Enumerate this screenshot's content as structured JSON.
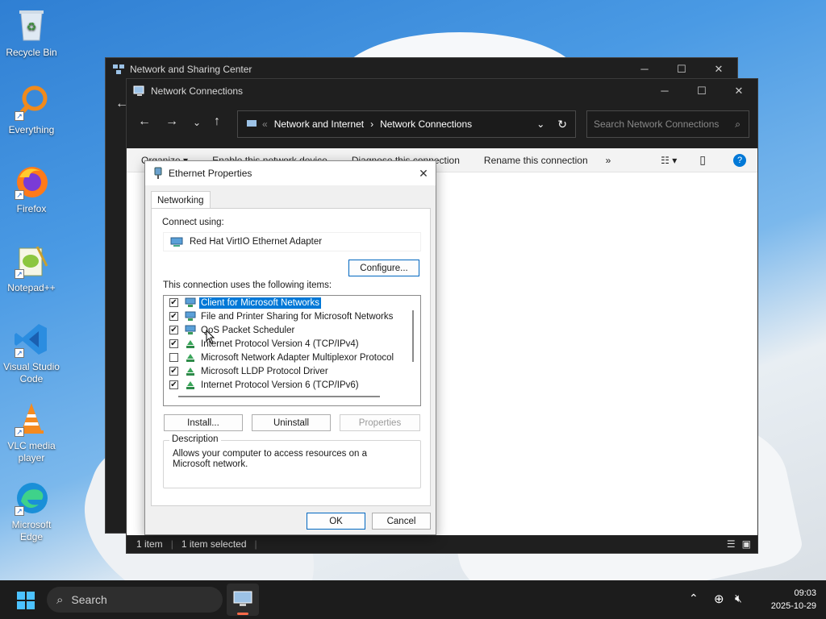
{
  "desktop": {
    "icons": [
      {
        "label": "Recycle Bin",
        "icon": "recycle-bin-icon"
      },
      {
        "label": "Everything",
        "icon": "everything-search-icon"
      },
      {
        "label": "Firefox",
        "icon": "firefox-icon"
      },
      {
        "label": "Notepad++",
        "icon": "notepad-plus-plus-icon"
      },
      {
        "label": "Visual Studio Code",
        "icon": "vscode-icon"
      },
      {
        "label": "VLC media player",
        "icon": "vlc-icon"
      },
      {
        "label": "Microsoft Edge",
        "icon": "edge-icon"
      }
    ]
  },
  "back_window": {
    "title": "Network and Sharing Center"
  },
  "explorer": {
    "title": "Network Connections",
    "breadcrumb": [
      "Network and Internet",
      "Network Connections"
    ],
    "search_placeholder": "Search Network Connections",
    "commands": [
      "Organize ▾",
      "Enable this network device",
      "Diagnose this connection",
      "Rename this connection",
      "»"
    ],
    "status": {
      "count": "1 item",
      "selected": "1 item selected"
    }
  },
  "dialog": {
    "title": "Ethernet Properties",
    "tab": "Networking",
    "connect_using_label": "Connect using:",
    "adapter": "Red Hat VirtIO Ethernet Adapter",
    "configure_label": "Configure...",
    "items_label": "This connection uses the following items:",
    "items": [
      {
        "label": "Client for Microsoft Networks",
        "checked": true,
        "selected": true,
        "icon": "network-client-icon"
      },
      {
        "label": "File and Printer Sharing for Microsoft Networks",
        "checked": true,
        "selected": false,
        "icon": "network-service-icon"
      },
      {
        "label": "QoS Packet Scheduler",
        "checked": true,
        "selected": false,
        "icon": "network-service-icon"
      },
      {
        "label": "Internet Protocol Version 4 (TCP/IPv4)",
        "checked": true,
        "selected": false,
        "icon": "protocol-icon"
      },
      {
        "label": "Microsoft Network Adapter Multiplexor Protocol",
        "checked": false,
        "selected": false,
        "icon": "protocol-icon"
      },
      {
        "label": "Microsoft LLDP Protocol Driver",
        "checked": true,
        "selected": false,
        "icon": "protocol-icon"
      },
      {
        "label": "Internet Protocol Version 6 (TCP/IPv6)",
        "checked": true,
        "selected": false,
        "icon": "protocol-icon"
      }
    ],
    "install_label": "Install...",
    "uninstall_label": "Uninstall",
    "properties_label": "Properties",
    "description_legend": "Description",
    "description_text": "Allows your computer to access resources on a Microsoft network.",
    "ok_label": "OK",
    "cancel_label": "Cancel"
  },
  "taskbar": {
    "search_label": "Search",
    "time": "09:03",
    "date": "2025-10-29"
  },
  "colors": {
    "accent": "#0078d7",
    "dark_chrome": "#1f1f1f"
  }
}
